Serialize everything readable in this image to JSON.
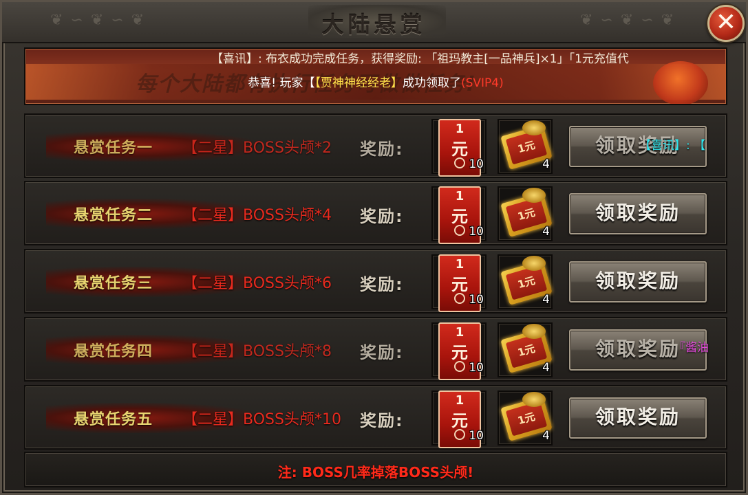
{
  "window": {
    "title": "大陆悬赏",
    "close_label": "✕",
    "ornament_left": "❦ ∽ ❦ ∽ ❦",
    "ornament_right": "❦ ∽ ❦ ∽ ❦"
  },
  "banner": {
    "slogan": "每个大陆都有执行任务可做做任务!",
    "ticker": "【喜讯】: 布衣成功完成任务，获得奖励: 「祖玛教主[一品神兵]×1」「1元充值代",
    "announce_prefix": "恭喜! 玩家【",
    "announce_name": "【贾神神经经老】",
    "announce_middle": "成功领取了",
    "announce_vip": "(SVIP4)"
  },
  "reward_label": "奖励:",
  "claim_label": "领取奖励",
  "tasks": [
    {
      "name": "悬赏任务一",
      "requirement": "【二星】BOSS头颅*2",
      "item1_line1": "1",
      "item1_line2": "元",
      "item1_count": "10",
      "item2_text": "1元",
      "item2_count": "4"
    },
    {
      "name": "悬赏任务二",
      "requirement": "【二星】BOSS头颅*4",
      "item1_line1": "1",
      "item1_line2": "元",
      "item1_count": "10",
      "item2_text": "1元",
      "item2_count": "4"
    },
    {
      "name": "悬赏任务三",
      "requirement": "【二星】BOSS头颅*6",
      "item1_line1": "1",
      "item1_line2": "元",
      "item1_count": "10",
      "item2_text": "1元",
      "item2_count": "4"
    },
    {
      "name": "悬赏任务四",
      "requirement": "【二星】BOSS头颅*8",
      "item1_line1": "1",
      "item1_line2": "元",
      "item1_count": "10",
      "item2_text": "1元",
      "item2_count": "4"
    },
    {
      "name": "悬赏任务五",
      "requirement": "【二星】BOSS头颅*10",
      "item1_line1": "1",
      "item1_line2": "元",
      "item1_count": "10",
      "item2_text": "1元",
      "item2_count": "4"
    }
  ],
  "overlays": {
    "cyan": "【喜讯】: 【",
    "purple": "『酱油"
  },
  "footer_note": "注: BOSS几率掉落BOSS头颅!",
  "colors": {
    "task_name": "#e8d470",
    "requirement": "#e82a1e",
    "announce_name": "#ffe14a",
    "vip": "#ff3a2a",
    "note": "#ff2a1a"
  }
}
